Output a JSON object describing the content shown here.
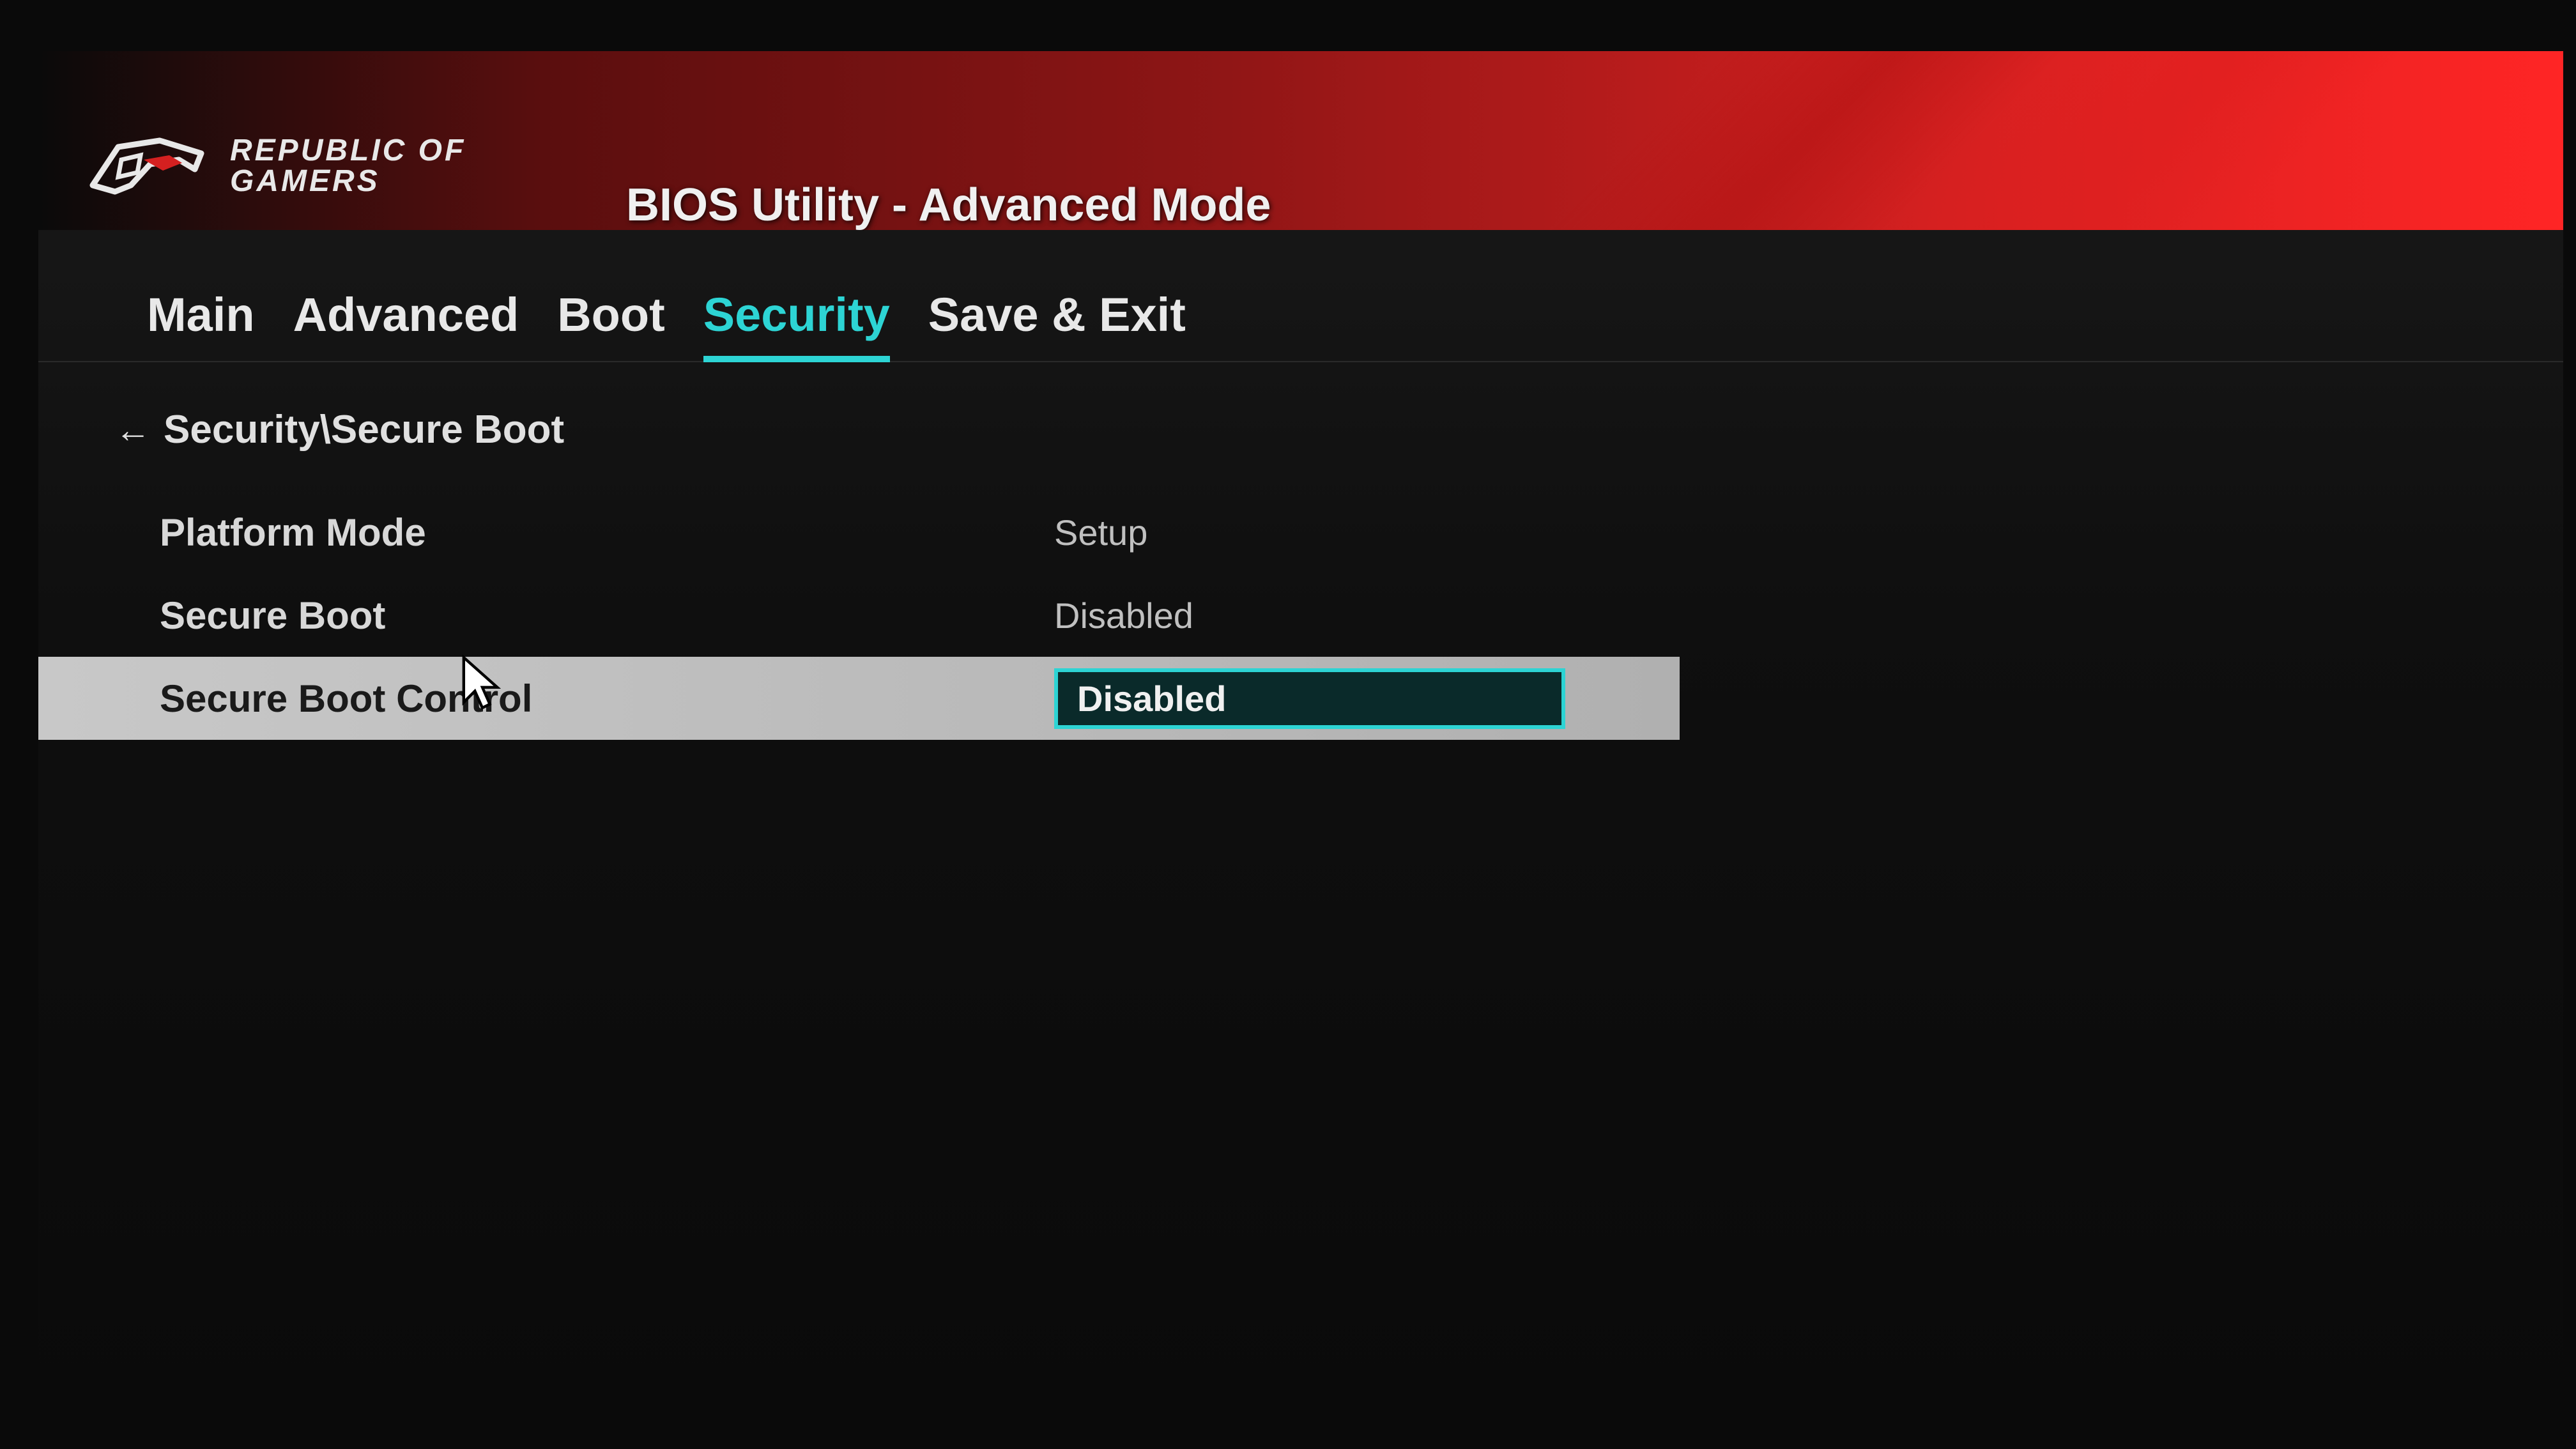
{
  "brand": {
    "line1": "REPUBLIC OF",
    "line2": "GAMERS"
  },
  "app_title": "BIOS Utility - Advanced Mode",
  "tabs": [
    {
      "label": "Main",
      "active": false
    },
    {
      "label": "Advanced",
      "active": false
    },
    {
      "label": "Boot",
      "active": false
    },
    {
      "label": "Security",
      "active": true
    },
    {
      "label": "Save & Exit",
      "active": false
    }
  ],
  "breadcrumb": "Security\\Secure Boot",
  "settings": [
    {
      "label": "Platform Mode",
      "value": "Setup",
      "type": "readonly"
    },
    {
      "label": "Secure Boot",
      "value": "Disabled",
      "type": "readonly"
    },
    {
      "label": "Secure Boot Control",
      "value": "Disabled",
      "type": "dropdown",
      "selected": true
    }
  ],
  "colors": {
    "accent": "#2dd4d4",
    "banner_red": "#d42020",
    "text": "#e8e8e8",
    "bg": "#0a0a0a"
  }
}
